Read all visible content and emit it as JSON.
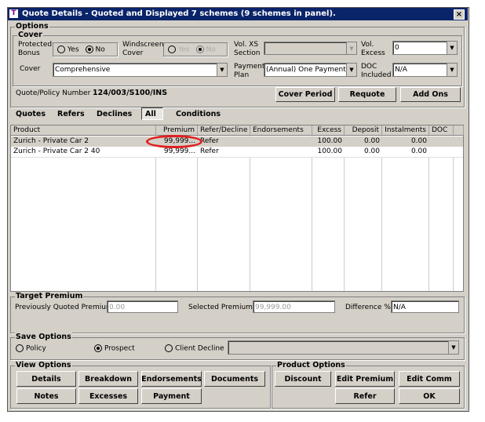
{
  "window": {
    "title": "Quote Details - Quoted and Displayed 7 schemes (9 schemes in panel).",
    "close": "×",
    "app_icon": "T"
  },
  "options": {
    "label": "Options",
    "cover_group": "Cover",
    "protected_bonus": {
      "label1": "Protected",
      "label2": "Bonus",
      "yes": "Yes",
      "no": "No",
      "selected": "No"
    },
    "windscreen_cover": {
      "label1": "Windscreen",
      "label2": "Cover",
      "yes": "Yes",
      "no": "No",
      "selected": "No",
      "disabled": true
    },
    "vol_xs_section": {
      "label1": "Vol. XS",
      "label2": "Section",
      "value": ""
    },
    "vol_excess": {
      "label1": "Vol.",
      "label2": "Excess",
      "value": "0"
    },
    "cover": {
      "label": "Cover",
      "value": "Comprehensive"
    },
    "payment_plan": {
      "label1": "Payment",
      "label2": "Plan",
      "value": "(Annual) One Payment Ir"
    },
    "doc_included": {
      "label1": "DOC",
      "label2": "Included",
      "value": "N/A"
    },
    "quote_number_label": "Quote/Policy Number",
    "quote_number": "124/003/S100/INS",
    "buttons": {
      "cover_period": "Cover Period",
      "requote": "Requote",
      "add_ons": "Add Ons"
    }
  },
  "tabs": [
    {
      "label": "Quotes"
    },
    {
      "label": "Refers"
    },
    {
      "label": "Declines"
    },
    {
      "label": "All",
      "active": true
    },
    {
      "label": "Conditions"
    }
  ],
  "table": {
    "columns": [
      "Product",
      "Premium",
      "Refer/Decline",
      "Endorsements",
      "Excess",
      "Deposit",
      "Instalments",
      "DOC"
    ],
    "rows": [
      [
        "Zurich - Private Car 2",
        "99,999...",
        "Refer",
        "",
        "100.00",
        "0.00",
        "0.00",
        ""
      ],
      [
        "Zurich - Private Car 2 40",
        "99,999...",
        "Refer",
        "",
        "100.00",
        "0.00",
        "0.00",
        ""
      ]
    ],
    "highlight_color": "#e02020"
  },
  "target_premium": {
    "label": "Target Premium",
    "prev_label": "Previously Quoted Premium",
    "prev_value": "0.00",
    "selected_label": "Selected Premium",
    "selected_value": "99,999.00",
    "diff_label": "Difference %",
    "diff_value": "N/A"
  },
  "save_options": {
    "label": "Save Options",
    "policy": "Policy",
    "prospect": "Prospect",
    "client_decline": "Client Decline",
    "selected": "Prospect",
    "combo_value": ""
  },
  "view_options": {
    "label": "View Options",
    "details": "Details",
    "breakdown": "Breakdown",
    "endorsements": "Endorsements",
    "documents": "Documents",
    "notes": "Notes",
    "excesses": "Excesses",
    "payment": "Payment"
  },
  "product_options": {
    "label": "Product Options",
    "discount": "Discount",
    "edit_premium": "Edit Premium",
    "edit_comm": "Edit Comm",
    "refer": "Refer",
    "ok": "OK"
  }
}
